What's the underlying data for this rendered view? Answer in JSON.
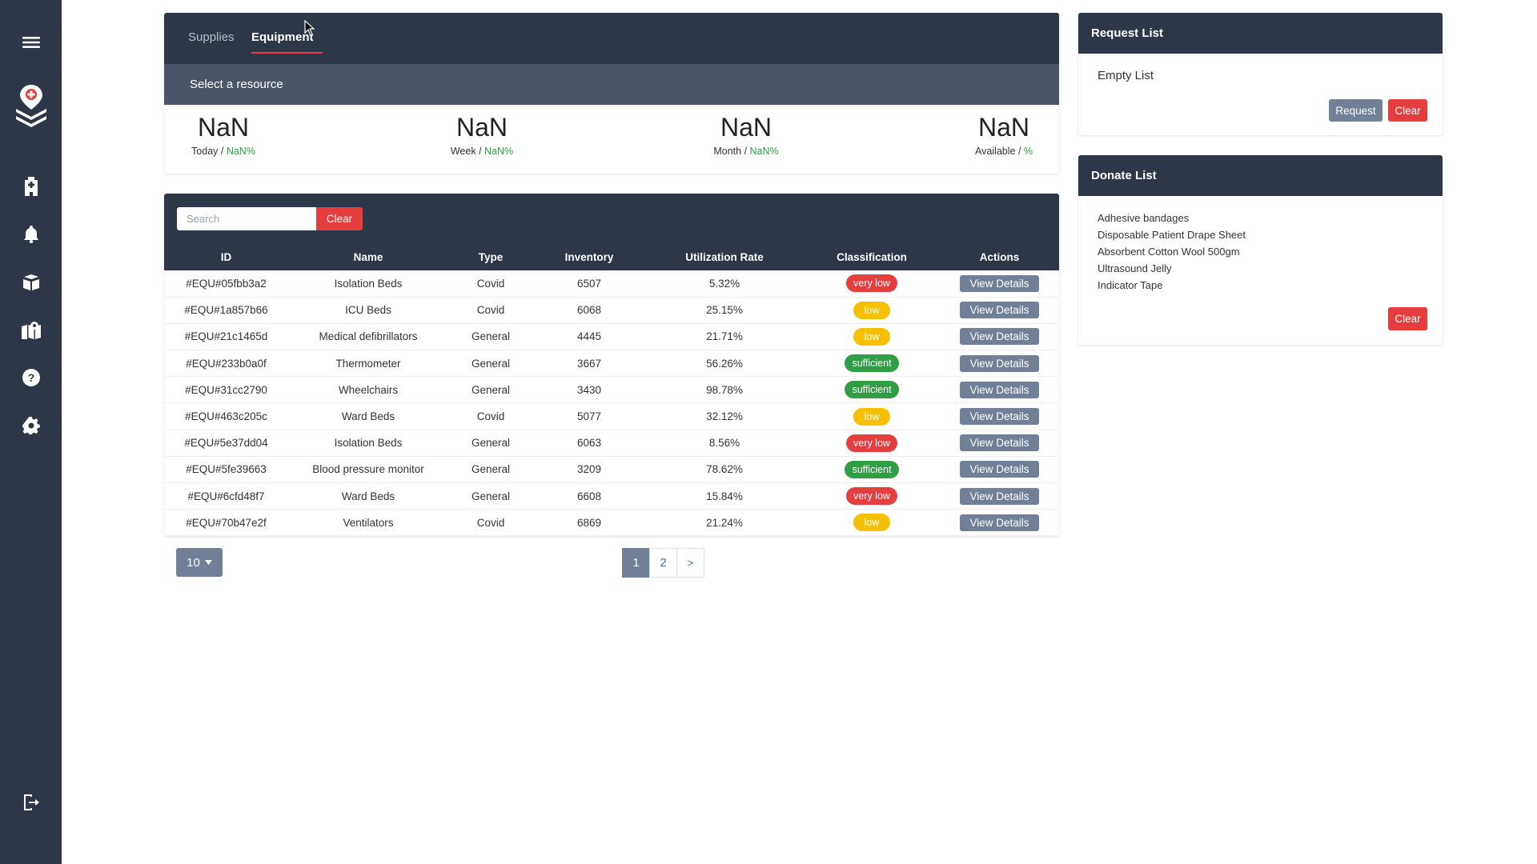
{
  "sidebar": {
    "icons": [
      "menu-icon",
      "logo-icon",
      "hospital-icon",
      "bell-icon",
      "box-icon",
      "map-icon",
      "help-icon",
      "gear-icon",
      "logout-icon"
    ]
  },
  "tabs": [
    {
      "label": "Supplies",
      "active": false
    },
    {
      "label": "Equipment",
      "active": true
    }
  ],
  "select_resource": "Select a resource",
  "stats": [
    {
      "value": "NaN",
      "label": "Today",
      "pct": "NaN%"
    },
    {
      "value": "NaN",
      "label": "Week",
      "pct": "NaN%"
    },
    {
      "value": "NaN",
      "label": "Month",
      "pct": "NaN%"
    },
    {
      "value": "NaN",
      "label": "Available",
      "pct": "%"
    }
  ],
  "search": {
    "placeholder": "Search",
    "value": "",
    "clear_label": "Clear"
  },
  "table": {
    "columns": [
      "ID",
      "Name",
      "Type",
      "Inventory",
      "Utilization Rate",
      "Classification",
      "Actions"
    ],
    "action_label": "View Details",
    "rows": [
      {
        "id": "#EQU#05fbb3a2",
        "name": "Isolation Beds",
        "type": "Covid",
        "inventory": "6507",
        "rate": "5.32%",
        "class": "very low"
      },
      {
        "id": "#EQU#1a857b66",
        "name": "ICU Beds",
        "type": "Covid",
        "inventory": "6068",
        "rate": "25.15%",
        "class": "low"
      },
      {
        "id": "#EQU#21c1465d",
        "name": "Medical defibrillators",
        "type": "General",
        "inventory": "4445",
        "rate": "21.71%",
        "class": "low"
      },
      {
        "id": "#EQU#233b0a0f",
        "name": "Thermometer",
        "type": "General",
        "inventory": "3667",
        "rate": "56.26%",
        "class": "sufficient"
      },
      {
        "id": "#EQU#31cc2790",
        "name": "Wheelchairs",
        "type": "General",
        "inventory": "3430",
        "rate": "98.78%",
        "class": "sufficient"
      },
      {
        "id": "#EQU#463c205c",
        "name": "Ward Beds",
        "type": "Covid",
        "inventory": "5077",
        "rate": "32.12%",
        "class": "low"
      },
      {
        "id": "#EQU#5e37dd04",
        "name": "Isolation Beds",
        "type": "General",
        "inventory": "6063",
        "rate": "8.56%",
        "class": "very low"
      },
      {
        "id": "#EQU#5fe39663",
        "name": "Blood pressure monitor",
        "type": "General",
        "inventory": "3209",
        "rate": "78.62%",
        "class": "sufficient"
      },
      {
        "id": "#EQU#6cfd48f7",
        "name": "Ward Beds",
        "type": "General",
        "inventory": "6608",
        "rate": "15.84%",
        "class": "very low"
      },
      {
        "id": "#EQU#70b47e2f",
        "name": "Ventilators",
        "type": "Covid",
        "inventory": "6869",
        "rate": "21.24%",
        "class": "low"
      }
    ]
  },
  "pagination": {
    "page_size": "10",
    "pages": [
      "1",
      "2"
    ],
    "next": ">",
    "current": "1"
  },
  "request_list": {
    "title": "Request List",
    "empty_text": "Empty List",
    "request_label": "Request",
    "clear_label": "Clear"
  },
  "donate_list": {
    "title": "Donate List",
    "items": [
      "Adhesive bandages",
      "Disposable Patient Drape Sheet",
      "Absorbent Cotton Wool 500gm",
      "Ultrasound Jelly",
      "Indicator Tape"
    ],
    "clear_label": "Clear"
  },
  "colors": {
    "sidebar": "#2d3748",
    "danger": "#e53e3e",
    "warning": "#f6c000",
    "success": "#2f9e44",
    "muted": "#718096"
  }
}
